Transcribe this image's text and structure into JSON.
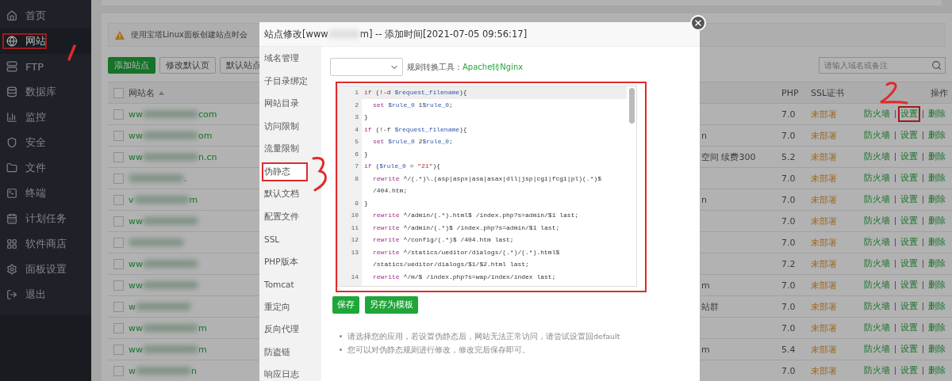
{
  "sidebar": {
    "items": [
      {
        "label": "首页",
        "selected": false,
        "annotated": false
      },
      {
        "label": "网站",
        "selected": true,
        "annotated": true
      },
      {
        "label": "FTP",
        "selected": false,
        "annotated": false
      },
      {
        "label": "数据库",
        "selected": false,
        "annotated": false
      },
      {
        "label": "监控",
        "selected": false,
        "annotated": false
      },
      {
        "label": "安全",
        "selected": false,
        "annotated": false
      },
      {
        "label": "文件",
        "selected": false,
        "annotated": false
      },
      {
        "label": "终端",
        "selected": false,
        "annotated": false
      },
      {
        "label": "计划任务",
        "selected": false,
        "annotated": false
      },
      {
        "label": "软件商店",
        "selected": false,
        "annotated": false
      },
      {
        "label": "面板设置",
        "selected": false,
        "annotated": false
      },
      {
        "label": "退出",
        "selected": false,
        "annotated": false
      }
    ]
  },
  "notice": {
    "text": "使用宝塔Linux面板创建站点时会"
  },
  "toolbar": {
    "buttons": [
      {
        "label": "添加站点",
        "kind": "primary"
      },
      {
        "label": "修改默认页",
        "kind": "default"
      },
      {
        "label": "默认站点",
        "kind": "default"
      }
    ],
    "search": {
      "placeholder": "请输入域名或备注"
    }
  },
  "table": {
    "header": {
      "checked": false,
      "name": "网站名",
      "php": "PHP",
      "ssl": "SSL证书",
      "actions": "操作"
    },
    "rows": [
      {
        "checked": false,
        "name_start": "ww",
        "name_end": "com",
        "php": "7.0",
        "ssl": "未部署",
        "actions": [
          {
            "label": "防火墙",
            "annotated": false
          },
          {
            "label": "设置",
            "annotated": true
          },
          {
            "label": "删除",
            "annotated": false
          }
        ]
      },
      {
        "checked": false,
        "name_start": "ww",
        "name_end": "om",
        "remark": "n",
        "php": "7.0",
        "ssl": "未部署",
        "actions": [
          {
            "label": "防火墙",
            "annotated": false
          },
          {
            "label": "设置",
            "annotated": false
          },
          {
            "label": "删除",
            "annotated": false
          }
        ]
      },
      {
        "checked": false,
        "name_start": "ww",
        "name_end": "n.cn",
        "remark": "空间 续费300",
        "php": "5.2",
        "ssl": "未部署",
        "actions": [
          {
            "label": "防火墙",
            "annotated": false
          },
          {
            "label": "设置",
            "annotated": false
          },
          {
            "label": "删除",
            "annotated": false
          }
        ]
      },
      {
        "checked": false,
        "name_end": ".",
        "php": "7.0",
        "ssl": "未部署",
        "actions": [
          {
            "label": "防火墙",
            "annotated": false
          },
          {
            "label": "设置",
            "annotated": false
          },
          {
            "label": "删除",
            "annotated": false
          }
        ]
      },
      {
        "checked": false,
        "name_start": "v",
        "name_end": "m",
        "remark": "n",
        "php": "7.0",
        "ssl": "未部署",
        "actions": [
          {
            "label": "防火墙",
            "annotated": false
          },
          {
            "label": "设置",
            "annotated": false
          },
          {
            "label": "删除",
            "annotated": false
          }
        ]
      },
      {
        "checked": false,
        "name_start": "ww",
        "php": "7.0",
        "ssl": "未部署",
        "actions": [
          {
            "label": "防火墙",
            "annotated": false
          },
          {
            "label": "设置",
            "annotated": false
          },
          {
            "label": "删除",
            "annotated": false
          }
        ]
      },
      {
        "checked": false,
        "php": "7.0",
        "ssl": "未部署",
        "actions": [
          {
            "label": "防火墙",
            "annotated": false
          },
          {
            "label": "设置",
            "annotated": false
          },
          {
            "label": "删除",
            "annotated": false
          }
        ]
      },
      {
        "checked": false,
        "name_start": "ww",
        "php": "7.2",
        "ssl": "未部署",
        "actions": [
          {
            "label": "防火墙",
            "annotated": false
          },
          {
            "label": "设置",
            "annotated": false
          },
          {
            "label": "删除",
            "annotated": false
          }
        ]
      },
      {
        "checked": false,
        "name_start": "ww",
        "remark": "m",
        "php": "7.0",
        "ssl": "未部署",
        "actions": [
          {
            "label": "防火墙",
            "annotated": false
          },
          {
            "label": "设置",
            "annotated": false
          },
          {
            "label": "删除",
            "annotated": false
          }
        ]
      },
      {
        "checked": false,
        "name_start": "w",
        "remark": "站群",
        "php": "7.0",
        "ssl": "未部署",
        "actions": [
          {
            "label": "防火墙",
            "annotated": false
          },
          {
            "label": "设置",
            "annotated": false
          },
          {
            "label": "删除",
            "annotated": false
          }
        ]
      },
      {
        "checked": false,
        "name_start": "ww",
        "name_end": "m",
        "php": "7.0",
        "ssl": "未部署",
        "actions": [
          {
            "label": "防火墙",
            "annotated": false
          },
          {
            "label": "设置",
            "annotated": false
          },
          {
            "label": "删除",
            "annotated": false
          }
        ]
      },
      {
        "checked": false,
        "name_start": "ww",
        "name_end": "m",
        "remark": "m",
        "php": "5.4",
        "ssl": "未部署",
        "actions": [
          {
            "label": "防火墙",
            "annotated": false
          },
          {
            "label": "设置",
            "annotated": false
          },
          {
            "label": "删除",
            "annotated": false
          }
        ]
      },
      {
        "checked": false,
        "name_start": "w",
        "name_end": "n",
        "php": "7.0",
        "ssl": "未部署",
        "actions": [
          {
            "label": "防火墙",
            "annotated": false
          },
          {
            "label": "设置",
            "annotated": false
          },
          {
            "label": "删除",
            "annotated": false
          }
        ]
      }
    ]
  },
  "modal": {
    "title_start": "站点修改[www",
    "title_end": "m] -- 添加时间[2021-07-05 09:56:17]",
    "menu": [
      {
        "label": "域名管理",
        "selected": false,
        "annotated": false
      },
      {
        "label": "子目录绑定",
        "selected": false,
        "annotated": false
      },
      {
        "label": "网站目录",
        "selected": false,
        "annotated": false
      },
      {
        "label": "访问限制",
        "selected": false,
        "annotated": false
      },
      {
        "label": "流量限制",
        "selected": false,
        "annotated": false
      },
      {
        "label": "伪静态",
        "selected": true,
        "annotated": true
      },
      {
        "label": "默认文档",
        "selected": false,
        "annotated": false
      },
      {
        "label": "配置文件",
        "selected": false,
        "annotated": false
      },
      {
        "label": "SSL",
        "selected": false,
        "annotated": false
      },
      {
        "label": "PHP版本",
        "selected": false,
        "annotated": false
      },
      {
        "label": "Tomcat",
        "selected": false,
        "annotated": false
      },
      {
        "label": "重定向",
        "selected": false,
        "annotated": false
      },
      {
        "label": "反向代理",
        "selected": false,
        "annotated": false
      },
      {
        "label": "防盗链",
        "selected": false,
        "annotated": false
      },
      {
        "label": "响应日志",
        "selected": false,
        "annotated": false
      }
    ],
    "converter_label": "规则转换工具：",
    "converter_link": "Apache转Nginx",
    "editor": {
      "annotated": true,
      "lines": [
        {
          "number": "1",
          "active": true,
          "indented": false,
          "tokens": [
            {
              "t": "if",
              "kind": "keyword"
            },
            {
              "t": " (!-d ",
              "kind": "plain"
            },
            {
              "t": "$request_filename",
              "kind": "variable"
            },
            {
              "t": "){",
              "kind": "plain"
            }
          ]
        },
        {
          "number": "2",
          "active": false,
          "indented": true,
          "tokens": [
            {
              "t": "set ",
              "kind": "keyword"
            },
            {
              "t": "$rule_0",
              "kind": "variable"
            },
            {
              "t": " 1",
              "kind": "plain"
            },
            {
              "t": "$rule_0",
              "kind": "variable"
            },
            {
              "t": ";",
              "kind": "plain"
            }
          ]
        },
        {
          "number": "3",
          "active": false,
          "indented": false,
          "tokens": [
            {
              "t": "}",
              "kind": "plain"
            }
          ]
        },
        {
          "number": "4",
          "active": false,
          "indented": false,
          "tokens": [
            {
              "t": "if",
              "kind": "keyword"
            },
            {
              "t": " (!-f ",
              "kind": "plain"
            },
            {
              "t": "$request_filename",
              "kind": "variable"
            },
            {
              "t": "){",
              "kind": "plain"
            }
          ]
        },
        {
          "number": "5",
          "active": false,
          "indented": true,
          "tokens": [
            {
              "t": "set ",
              "kind": "keyword"
            },
            {
              "t": "$rule_0",
              "kind": "variable"
            },
            {
              "t": " 2",
              "kind": "plain"
            },
            {
              "t": "$rule_0",
              "kind": "variable"
            },
            {
              "t": ";",
              "kind": "plain"
            }
          ]
        },
        {
          "number": "6",
          "active": false,
          "indented": false,
          "tokens": [
            {
              "t": "}",
              "kind": "plain"
            }
          ]
        },
        {
          "number": "7",
          "active": false,
          "indented": false,
          "tokens": [
            {
              "t": "if",
              "kind": "keyword"
            },
            {
              "t": " (",
              "kind": "plain"
            },
            {
              "t": "$rule_0",
              "kind": "variable"
            },
            {
              "t": " = ",
              "kind": "plain"
            },
            {
              "t": "\"21\"",
              "kind": "string"
            },
            {
              "t": "){",
              "kind": "plain"
            }
          ]
        },
        {
          "number": "8",
          "active": false,
          "indented": true,
          "tokens": [
            {
              "t": "rewrite",
              "kind": "keyword"
            },
            {
              "t": " ^/(.*)\\.(asp|aspx|asa|asax|dll|jsp|cgi|fcgi|pl)(.*)$ /404.htm;",
              "kind": "plain"
            }
          ]
        },
        {
          "number": "9",
          "active": false,
          "indented": false,
          "tokens": [
            {
              "t": "}",
              "kind": "plain"
            }
          ]
        },
        {
          "number": "10",
          "active": false,
          "indented": true,
          "tokens": [
            {
              "t": "rewrite",
              "kind": "keyword"
            },
            {
              "t": " ^/admin/(.*).html$ /index.php?s=admin/$1 last;",
              "kind": "plain"
            }
          ]
        },
        {
          "number": "11",
          "active": false,
          "indented": true,
          "tokens": [
            {
              "t": "rewrite",
              "kind": "keyword"
            },
            {
              "t": " ^/admin/(.*)$ /index.php?s=admin/$1 last;",
              "kind": "plain"
            }
          ]
        },
        {
          "number": "12",
          "active": false,
          "indented": true,
          "tokens": [
            {
              "t": "rewrite",
              "kind": "keyword"
            },
            {
              "t": " ^/config/(.*)$ /404.htm last;",
              "kind": "plain"
            }
          ]
        },
        {
          "number": "13",
          "active": false,
          "indented": true,
          "tokens": [
            {
              "t": "rewrite",
              "kind": "keyword"
            },
            {
              "t": " ^/statics/ueditor/dialogs/(.*)/(.*).html$ /statics/ueditor/dialogs/$1/$2.html last;",
              "kind": "plain"
            }
          ]
        },
        {
          "number": "14",
          "active": false,
          "indented": true,
          "tokens": [
            {
              "t": "rewrite",
              "kind": "keyword"
            },
            {
              "t": " ^/m/$ /index.php?s=wap/index/index last;",
              "kind": "plain"
            }
          ]
        }
      ]
    },
    "buttons": [
      "保存",
      "另存为模板"
    ],
    "notes": [
      "请选择您的应用，若设置伪静态后，网站无法正常访问，请尝试设置回default",
      "您可以对伪静态规则进行修改，修改完后保存即可。"
    ]
  }
}
